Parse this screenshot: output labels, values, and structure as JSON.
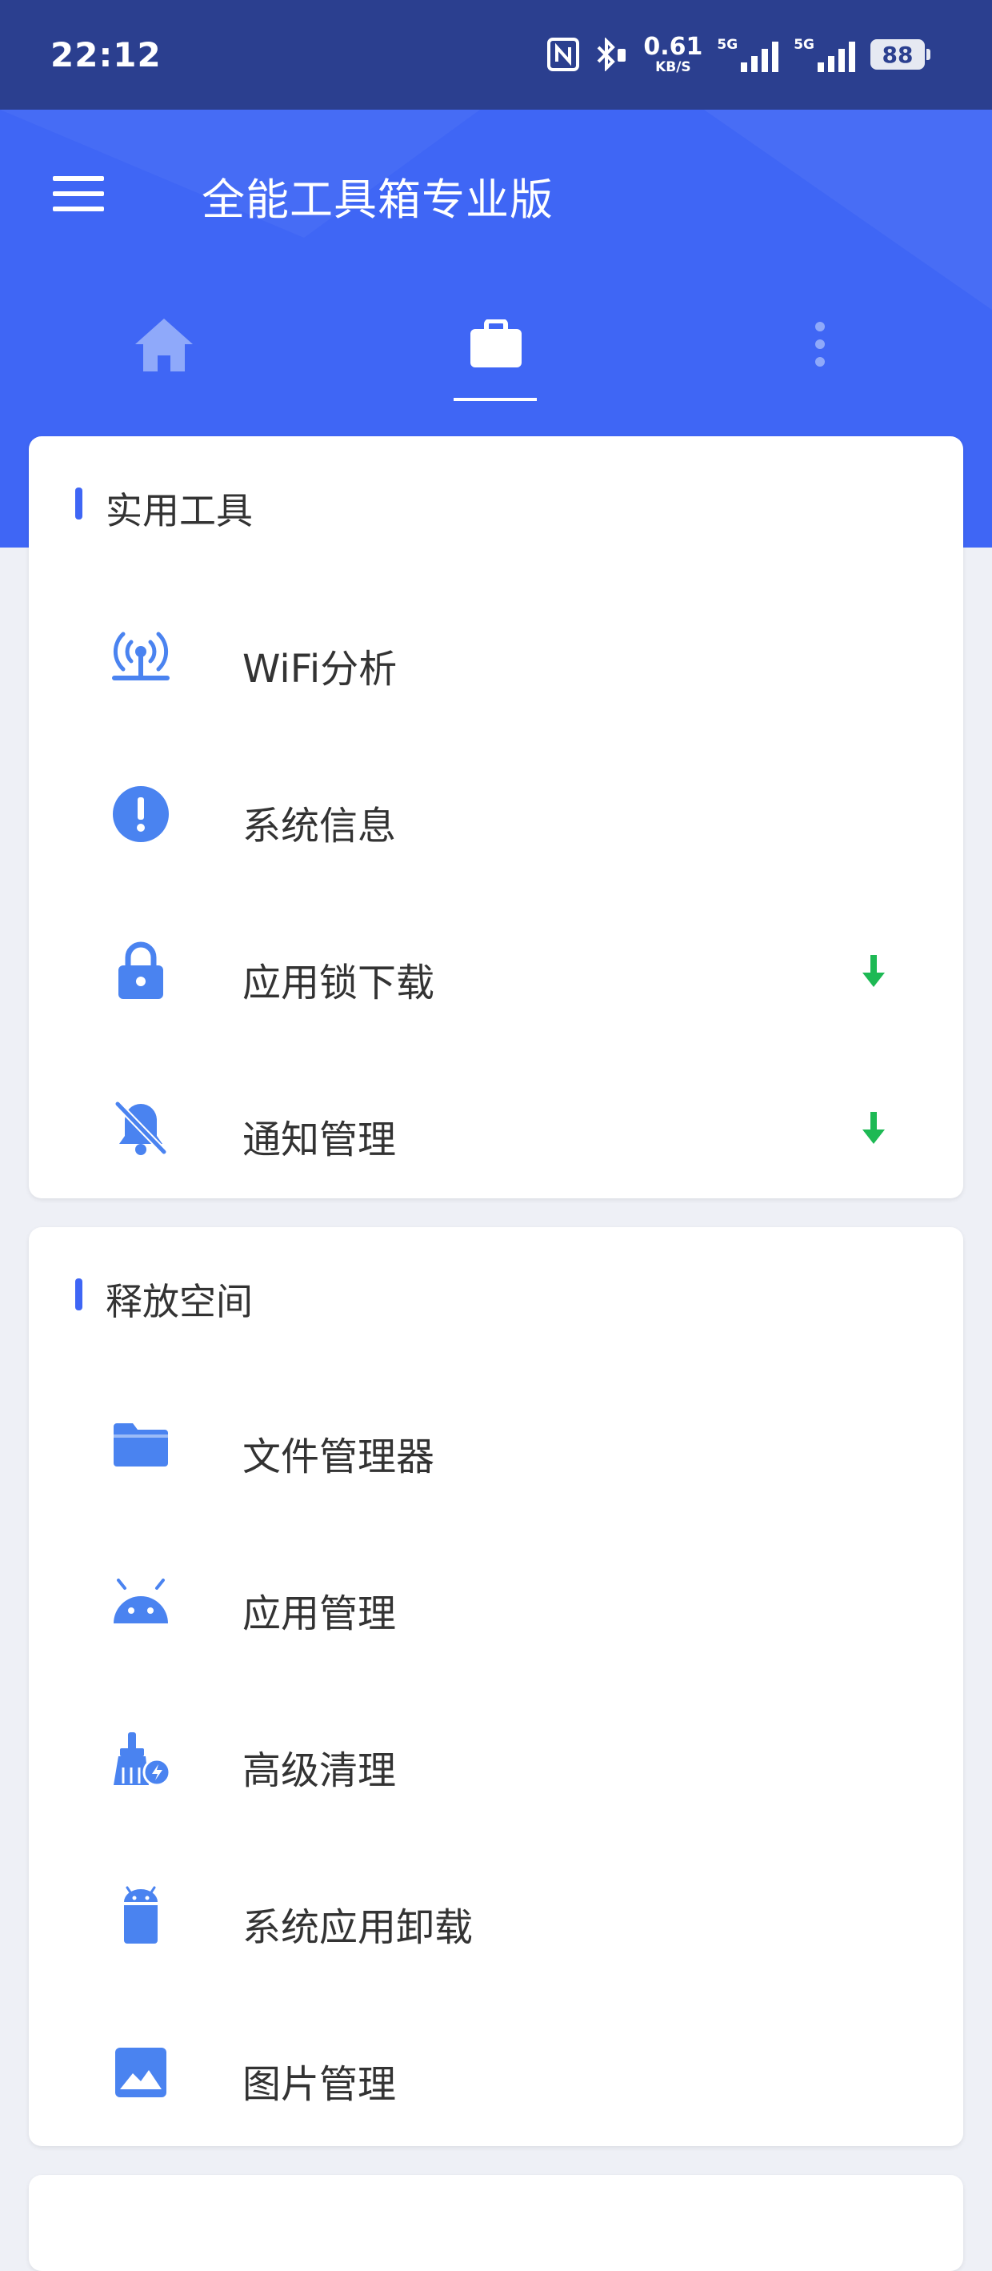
{
  "status_bar": {
    "time": "22:12",
    "net_speed_value": "0.61",
    "net_speed_unit": "KB/S",
    "sim1_label": "5G",
    "sim2_label": "5G",
    "battery": "88"
  },
  "app_bar": {
    "title": "全能工具箱专业版",
    "tabs": [
      {
        "icon": "home-icon",
        "selected": false
      },
      {
        "icon": "briefcase-icon",
        "selected": true
      },
      {
        "icon": "more-vertical-icon",
        "selected": false
      }
    ]
  },
  "sections": [
    {
      "title": "实用工具",
      "items": [
        {
          "label": "WiFi分析",
          "icon": "wifi-tower-icon",
          "download": false
        },
        {
          "label": "系统信息",
          "icon": "info-alert-icon",
          "download": false
        },
        {
          "label": "应用锁下载",
          "icon": "lock-icon",
          "download": true
        },
        {
          "label": "通知管理",
          "icon": "bell-off-icon",
          "download": true
        }
      ]
    },
    {
      "title": "释放空间",
      "items": [
        {
          "label": "文件管理器",
          "icon": "folder-icon"
        },
        {
          "label": "应用管理",
          "icon": "android-icon"
        },
        {
          "label": "高级清理",
          "icon": "broom-icon"
        },
        {
          "label": "系统应用卸载",
          "icon": "android-trash-icon"
        },
        {
          "label": "图片管理",
          "icon": "image-icon"
        }
      ]
    }
  ],
  "colors": {
    "status_bar_bg": "#2B3F8F",
    "app_bar_bg": "#3F66F5",
    "icon_blue": "#4A83F0",
    "download_green": "#1DB954",
    "page_bg": "#EEF0F6"
  }
}
